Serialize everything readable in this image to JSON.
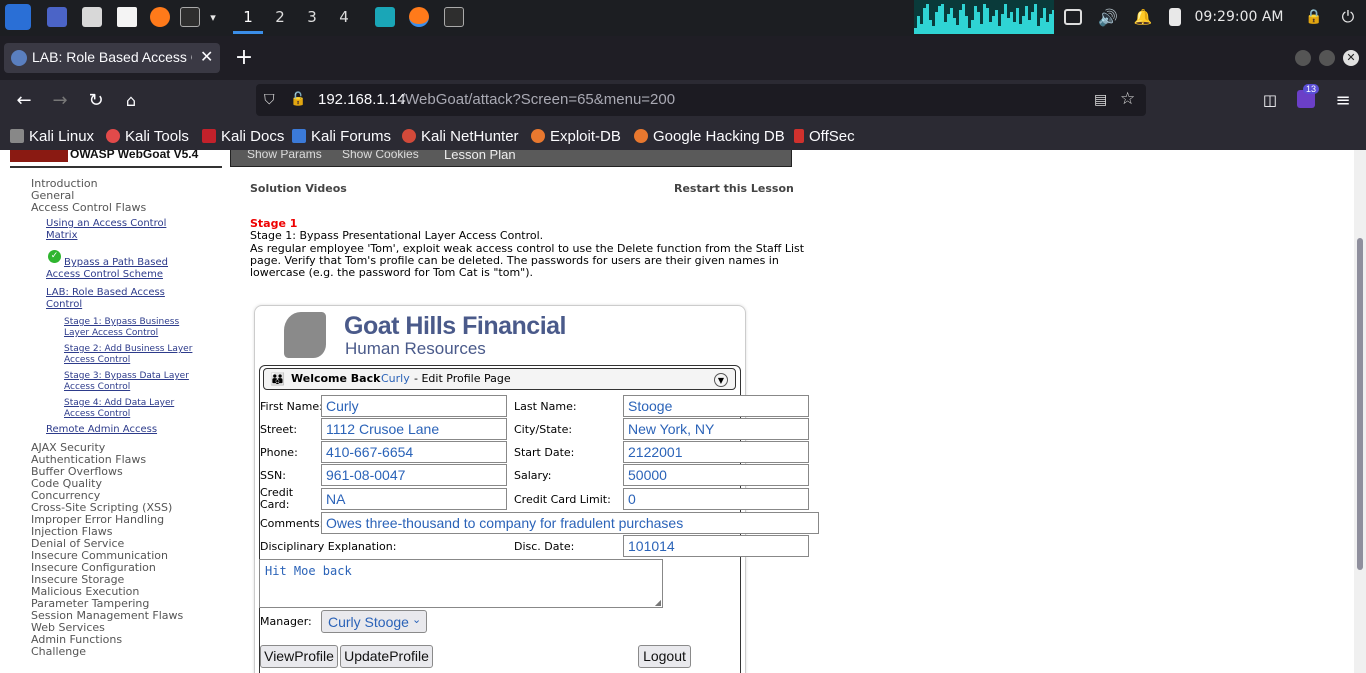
{
  "taskbar": {
    "workspaces": [
      "1",
      "2",
      "3",
      "4"
    ],
    "clock": "09:29:00 AM"
  },
  "browser": {
    "tab_title": "LAB: Role Based Access C",
    "url_host": "192.168.1.14",
    "url_path": "/WebGoat/attack?Screen=65&menu=200",
    "extension_badge": "13",
    "bookmarks": [
      "Kali Linux",
      "Kali Tools",
      "Kali Docs",
      "Kali Forums",
      "Kali NetHunter",
      "Exploit-DB",
      "Google Hacking DB",
      "OffSec"
    ]
  },
  "webgoat": {
    "logo_text": "OWASP WebGoat V5.4",
    "header_links": [
      "Show Params",
      "Show Cookies",
      "Lesson Plan"
    ],
    "solution_videos": "Solution Videos",
    "restart_lesson": "Restart this Lesson",
    "stage_label": "Stage 1",
    "stage_text": "Stage 1: Bypass Presentational Layer Access Control.",
    "instructions_line1": "As regular employee 'Tom', exploit weak access control to use the Delete function from the Staff List",
    "instructions_line2": "page. Verify that Tom's profile can be deleted. The passwords for users are their given names in",
    "instructions_line3": "lowercase (e.g. the password for Tom Cat is \"tom\")."
  },
  "sidebar": {
    "top": [
      "Introduction",
      "General",
      "Access Control Flaws"
    ],
    "acf_items": [
      {
        "line1": "Using an Access Control",
        "line2": "Matrix"
      },
      {
        "line1": "Bypass a Path Based",
        "line2": "Access Control Scheme"
      },
      {
        "line1": "LAB: Role Based Access",
        "line2": "Control"
      }
    ],
    "stages": [
      {
        "line1": "Stage 1: Bypass Business",
        "line2": "Layer Access Control"
      },
      {
        "line1": "Stage 2: Add Business Layer",
        "line2": "Access Control"
      },
      {
        "line1": "Stage 3: Bypass Data Layer",
        "line2": "Access Control"
      },
      {
        "line1": "Stage 4: Add Data Layer",
        "line2": "Access Control"
      }
    ],
    "remote_admin": "Remote Admin Access",
    "categories": [
      "AJAX Security",
      "Authentication Flaws",
      "Buffer Overflows",
      "Code Quality",
      "Concurrency",
      "Cross-Site Scripting (XSS)",
      "Improper Error Handling",
      "Injection Flaws",
      "Denial of Service",
      "Insecure Communication",
      "Insecure Configuration",
      "Insecure Storage",
      "Malicious Execution",
      "Parameter Tampering",
      "Session Management Flaws",
      "Web Services",
      "Admin Functions",
      "Challenge"
    ]
  },
  "ghf": {
    "title_line1": "Goat Hills Financial",
    "title_line2": "Human Resources",
    "welcome_prefix": "Welcome Back",
    "user": "Curly",
    "welcome_suffix": "- Edit Profile Page",
    "labels": {
      "first_name": "First Name:",
      "last_name": "Last Name:",
      "street": "Street:",
      "city_state": "City/State:",
      "phone": "Phone:",
      "start_date": "Start Date:",
      "ssn": "SSN:",
      "salary": "Salary:",
      "credit_card_1": "Credit",
      "credit_card_2": "Card:",
      "credit_card_limit": "Credit Card Limit:",
      "comments": "Comments:",
      "disc_explanation": "Disciplinary Explanation:",
      "disc_date": "Disc. Date:",
      "manager": "Manager:"
    },
    "values": {
      "first_name": "Curly",
      "last_name": "Stooge",
      "street": "1112 Crusoe Lane",
      "city_state": "New York, NY",
      "phone": "410-667-6654",
      "start_date": "2122001",
      "ssn": "961-08-0047",
      "salary": "50000",
      "credit_card": "NA",
      "credit_card_limit": "0",
      "comments": "Owes three-thousand to company for fradulent purchases",
      "disc_date": "101014",
      "disc_explanation": "Hit Moe back",
      "manager": "Curly Stooge"
    },
    "buttons": {
      "view": "ViewProfile",
      "update": "UpdateProfile",
      "logout": "Logout"
    }
  }
}
